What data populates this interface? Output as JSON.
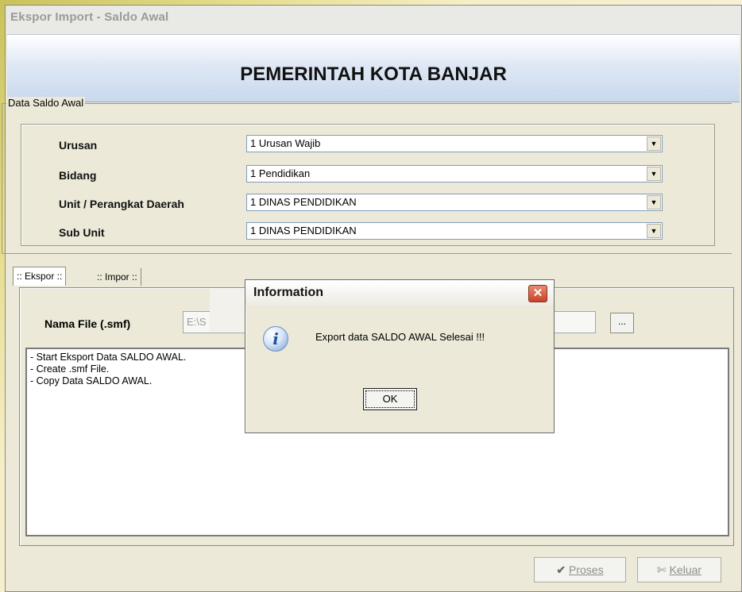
{
  "window": {
    "title": "Ekspor Import - Saldo Awal"
  },
  "banner": {
    "title": "PEMERINTAH KOTA BANJAR"
  },
  "group": {
    "label": "Data Saldo Awal"
  },
  "fields": [
    {
      "label": "Urusan",
      "value": "1  Urusan Wajib"
    },
    {
      "label": "Bidang",
      "value": "1  Pendidikan"
    },
    {
      "label": "Unit / Perangkat Daerah",
      "value": "1  DINAS PENDIDIKAN"
    },
    {
      "label": "Sub Unit",
      "value": "1  DINAS PENDIDIKAN"
    }
  ],
  "tabs": [
    {
      "label": ":: Ekspor ::",
      "active": true
    },
    {
      "label": ":: Impor ::",
      "active": false
    }
  ],
  "ekspor": {
    "file_label": "Nama File (.smf)",
    "file_value": "E:\\S",
    "browse_label": "...",
    "log": [
      "- Start Eksport Data SALDO AWAL.",
      "- Create .smf File.",
      "- Copy Data SALDO AWAL."
    ]
  },
  "buttons": {
    "proses": {
      "icon": "check-icon",
      "label": "Proses"
    },
    "keluar": {
      "icon": "exit-icon",
      "label": "Keluar"
    }
  },
  "dialog": {
    "title": "Information",
    "close": "✕",
    "icon": "info-icon",
    "message": "Export data SALDO AWAL Selesai !!!",
    "ok": "OK"
  }
}
